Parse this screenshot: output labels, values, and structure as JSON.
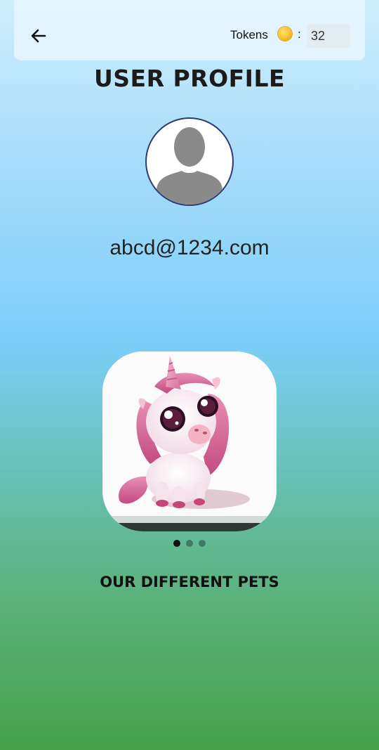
{
  "header": {
    "tokens_label": "Tokens",
    "colon": ":",
    "token_count": "32"
  },
  "profile": {
    "title": "User Profile",
    "email": "abcd@1234.com"
  },
  "carousel": {
    "current_slide": 1,
    "slide_count": 3
  },
  "pets": {
    "section_title": "our different pets"
  },
  "colors": {
    "avatar_border": "#2e3a72",
    "coin": "#f5c12a",
    "active_dot": "#111111",
    "inactive_dot": "#3e7a68"
  },
  "icons": {
    "back": "arrow-left-icon",
    "coin": "coin-icon",
    "avatar": "user-silhouette-icon"
  }
}
